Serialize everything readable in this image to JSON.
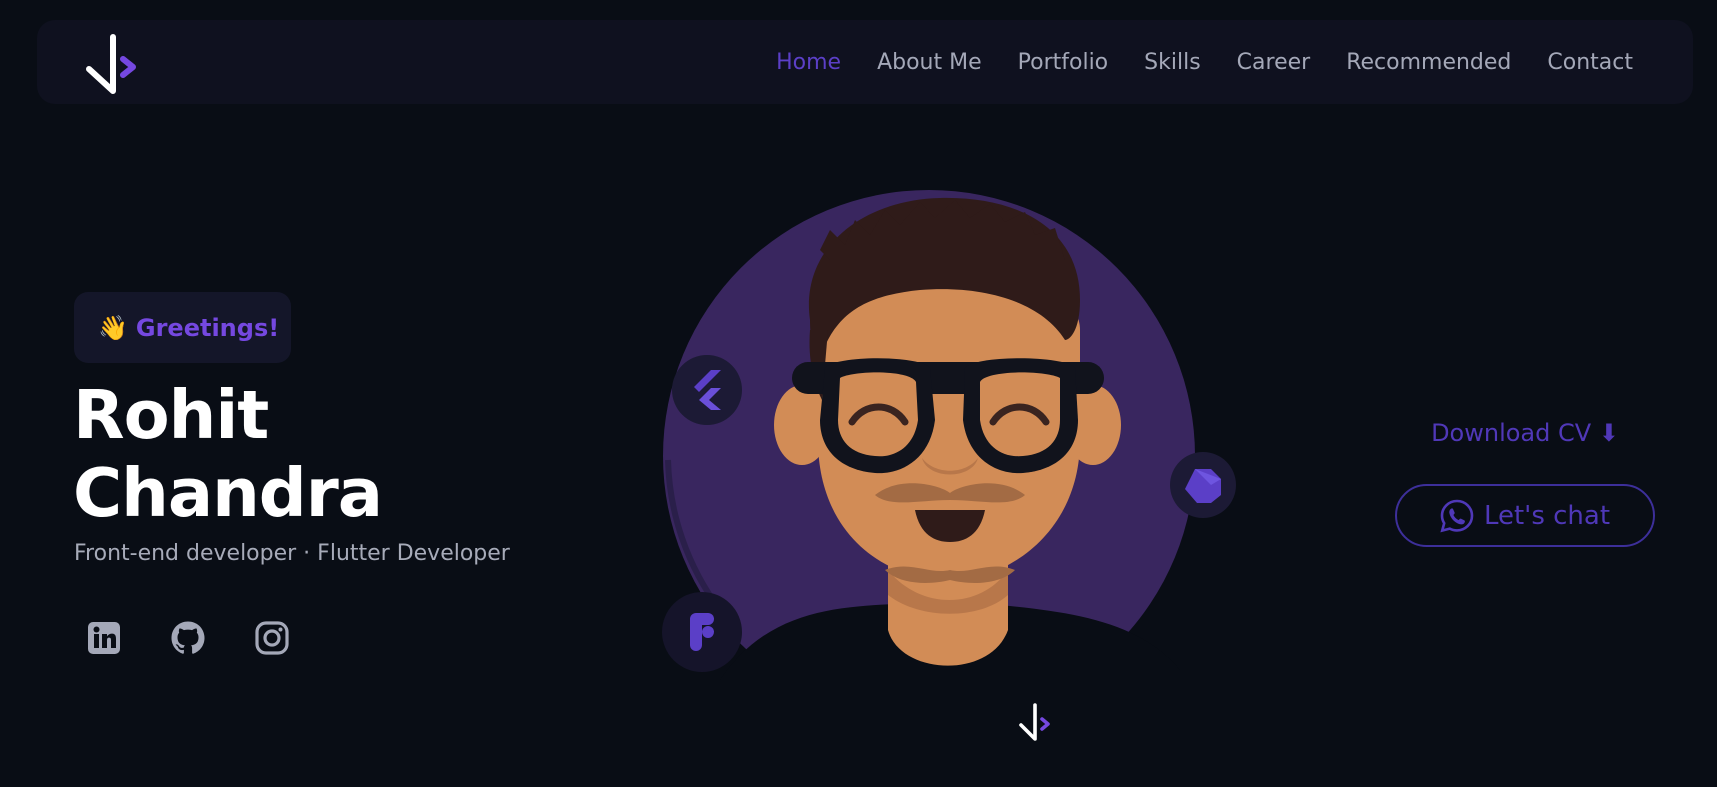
{
  "nav": {
    "logo": "code-logo",
    "items": [
      {
        "label": "Home",
        "active": true
      },
      {
        "label": "About Me",
        "active": false
      },
      {
        "label": "Portfolio",
        "active": false
      },
      {
        "label": "Skills",
        "active": false
      },
      {
        "label": "Career",
        "active": false
      },
      {
        "label": "Recommended",
        "active": false
      },
      {
        "label": "Contact",
        "active": false
      }
    ]
  },
  "hero": {
    "greeting": "Greetings!",
    "greeting_emoji": "👋",
    "name_line1": "Rohit",
    "name_line2": "Chandra",
    "subtitle": "Front-end developer · Flutter Developer",
    "socials": [
      "linkedin-icon",
      "github-icon",
      "instagram-icon"
    ]
  },
  "avatar": {
    "tech_icons": [
      "flutter-icon",
      "dart-icon",
      "figma-icon"
    ]
  },
  "cta": {
    "download_label": "Download CV ⬇",
    "chat_label": "Let's chat"
  },
  "colors": {
    "background": "#090d15",
    "navbar": "#0f111f",
    "accent": "#7548e0",
    "avatar_circle": "#39265f",
    "muted_text": "#a4a8b8"
  }
}
